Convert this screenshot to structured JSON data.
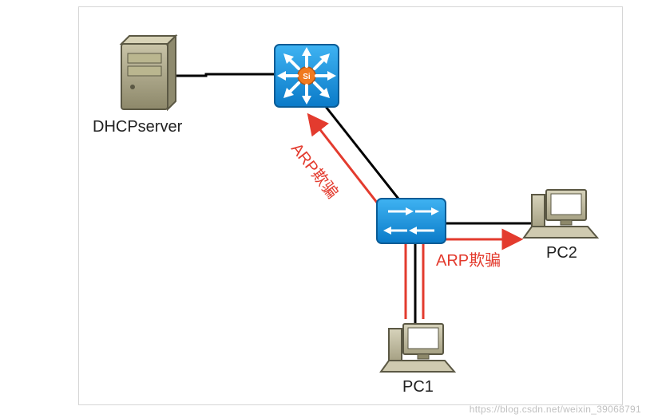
{
  "labels": {
    "dhcp_server": "DHCPserver",
    "pc1": "PC1",
    "pc2": "PC2",
    "arp_spoof_1": "ARP欺骗",
    "arp_spoof_2": "ARP欺骗"
  },
  "watermark": "https://blog.csdn.net/weixin_39068791",
  "chart_data": {
    "type": "diagram",
    "title": "",
    "nodes": [
      {
        "id": "dhcp_server",
        "type": "server",
        "label": "DHCPserver"
      },
      {
        "id": "l3_switch",
        "type": "layer3-switch",
        "label": ""
      },
      {
        "id": "l2_switch",
        "type": "layer2-switch",
        "label": ""
      },
      {
        "id": "pc1",
        "type": "pc",
        "label": "PC1"
      },
      {
        "id": "pc2",
        "type": "pc",
        "label": "PC2"
      }
    ],
    "links": [
      {
        "from": "dhcp_server",
        "to": "l3_switch"
      },
      {
        "from": "l3_switch",
        "to": "l2_switch"
      },
      {
        "from": "l2_switch",
        "to": "pc1"
      },
      {
        "from": "l2_switch",
        "to": "pc2"
      }
    ],
    "attacks": [
      {
        "from": "pc1",
        "via": "l2_switch",
        "to": "l3_switch",
        "label": "ARP欺骗"
      },
      {
        "from": "pc1",
        "via": "l2_switch",
        "to": "pc2",
        "label": "ARP欺骗"
      }
    ]
  }
}
